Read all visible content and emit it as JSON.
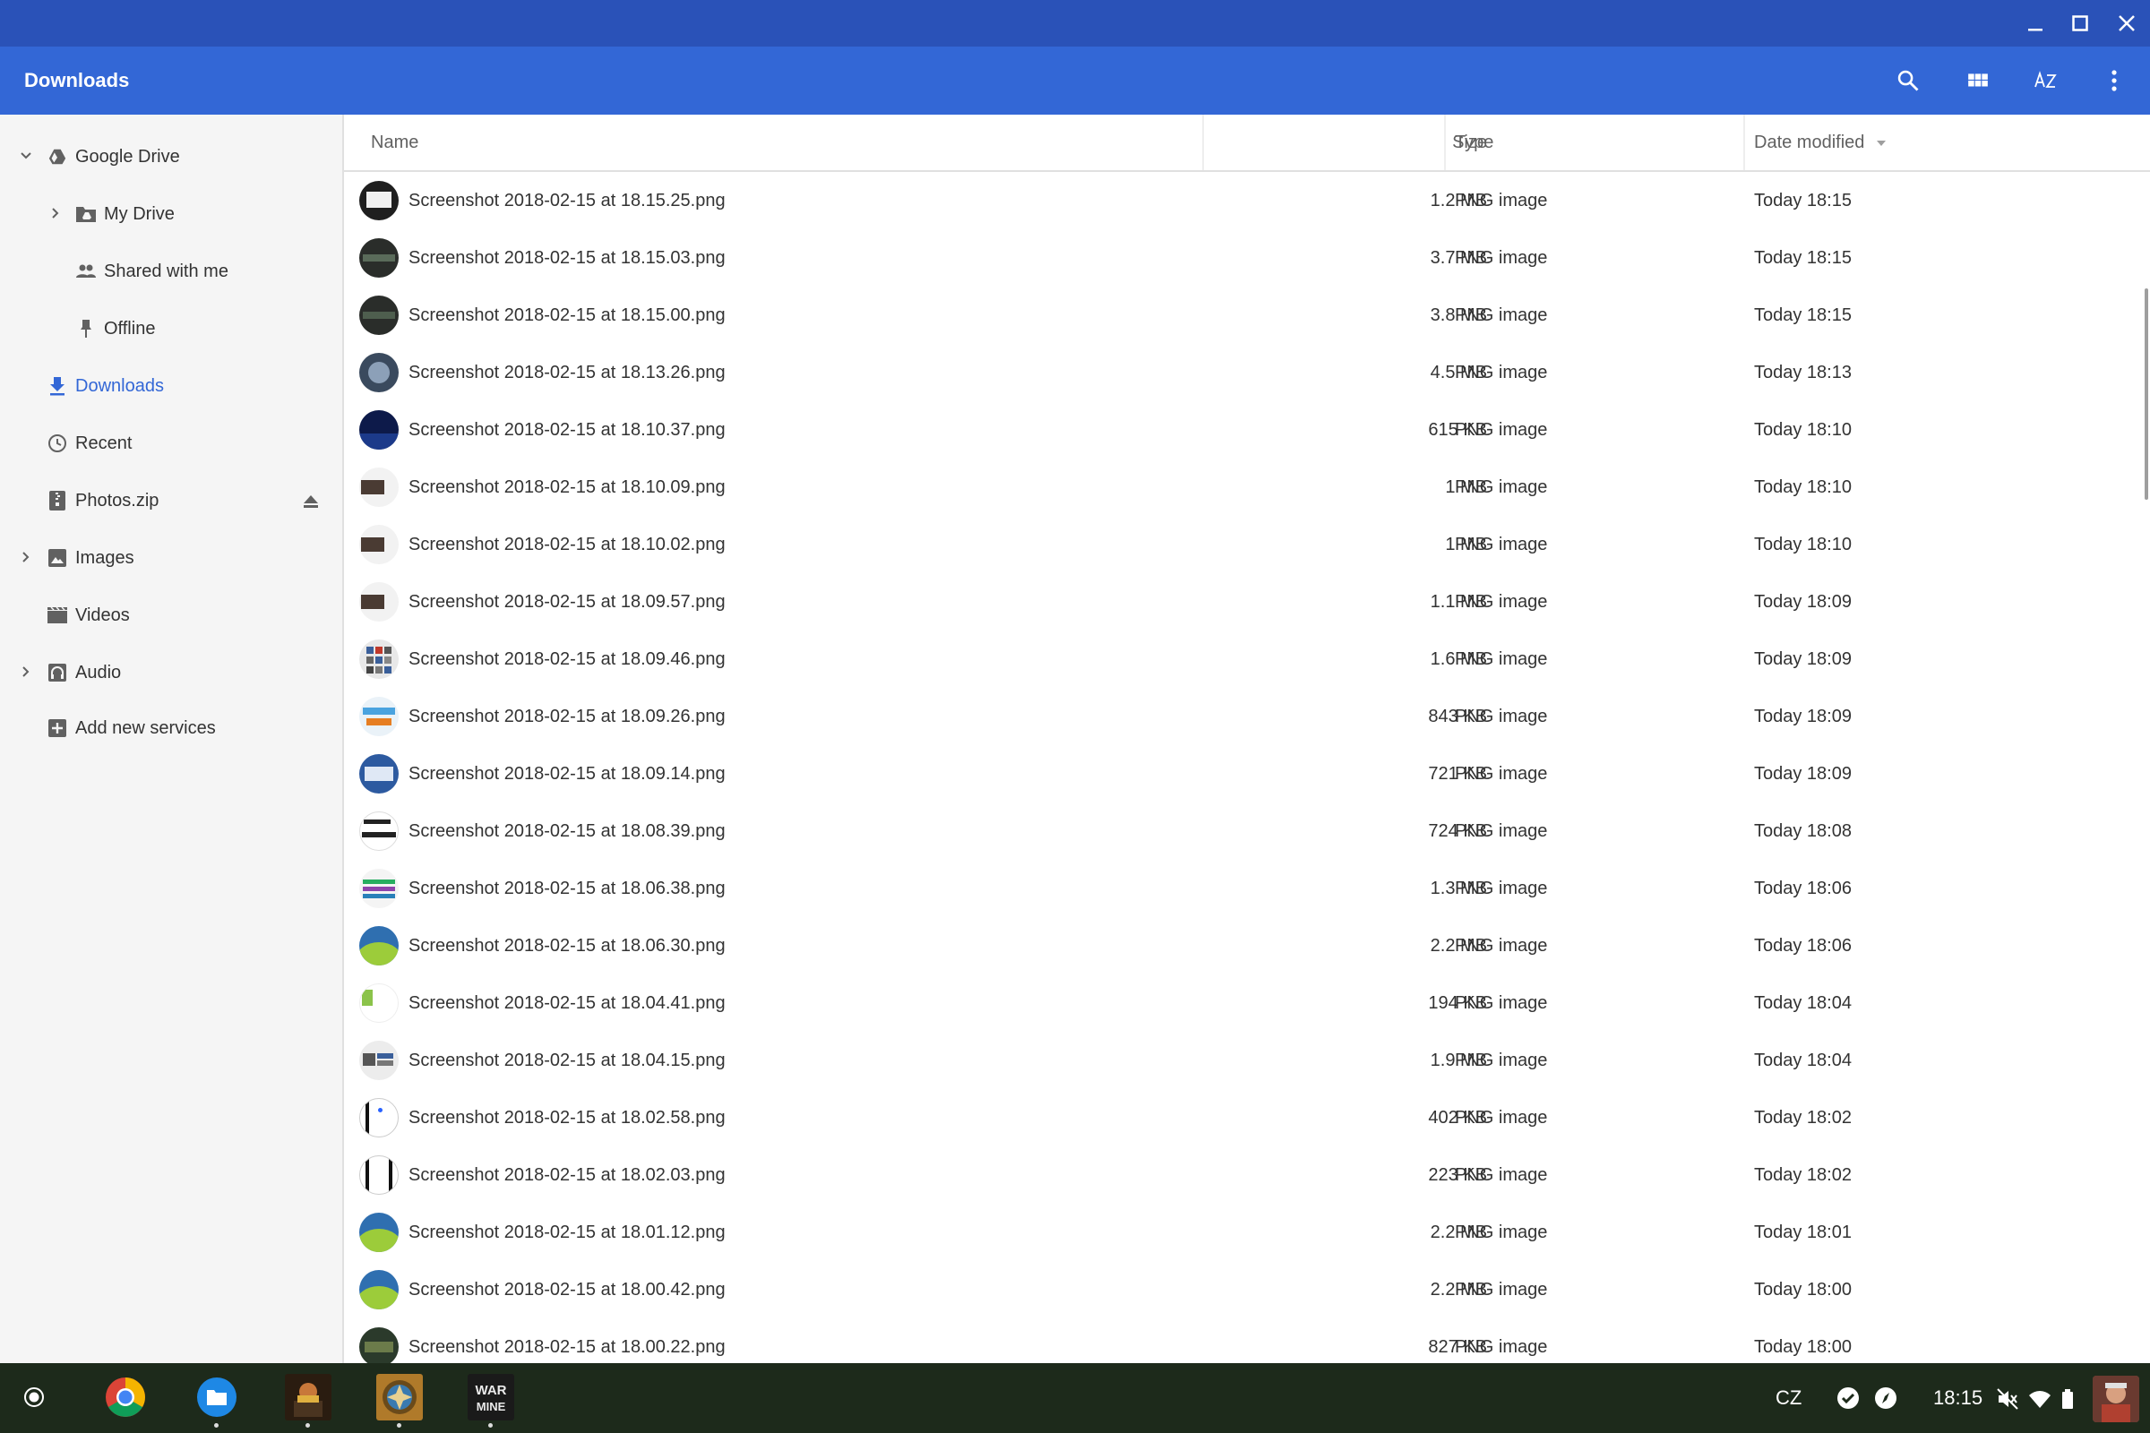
{
  "app": {
    "title": "Downloads"
  },
  "sidebar": {
    "items": [
      {
        "label": "Google Drive",
        "icon": "google-drive-icon"
      },
      {
        "label": "My Drive",
        "icon": "folder-drive-icon"
      },
      {
        "label": "Shared with me",
        "icon": "people-icon"
      },
      {
        "label": "Offline",
        "icon": "pin-icon"
      },
      {
        "label": "Downloads",
        "icon": "download-icon"
      },
      {
        "label": "Recent",
        "icon": "clock-icon"
      },
      {
        "label": "Photos.zip",
        "icon": "archive-icon"
      },
      {
        "label": "Images",
        "icon": "image-icon"
      },
      {
        "label": "Videos",
        "icon": "video-icon"
      },
      {
        "label": "Audio",
        "icon": "audio-icon"
      },
      {
        "label": "Add new services",
        "icon": "add-box-icon"
      }
    ]
  },
  "table": {
    "columns": {
      "name": "Name",
      "size": "Size",
      "type": "Type",
      "date": "Date modified"
    },
    "rows": [
      {
        "name": "Screenshot 2018-02-15 at 18.15.25.png",
        "size": "1.2 MB",
        "type": "PNG image",
        "date": "Today 18:15"
      },
      {
        "name": "Screenshot 2018-02-15 at 18.15.03.png",
        "size": "3.7 MB",
        "type": "PNG image",
        "date": "Today 18:15"
      },
      {
        "name": "Screenshot 2018-02-15 at 18.15.00.png",
        "size": "3.8 MB",
        "type": "PNG image",
        "date": "Today 18:15"
      },
      {
        "name": "Screenshot 2018-02-15 at 18.13.26.png",
        "size": "4.5 MB",
        "type": "PNG image",
        "date": "Today 18:13"
      },
      {
        "name": "Screenshot 2018-02-15 at 18.10.37.png",
        "size": "615 KB",
        "type": "PNG image",
        "date": "Today 18:10"
      },
      {
        "name": "Screenshot 2018-02-15 at 18.10.09.png",
        "size": "1 MB",
        "type": "PNG image",
        "date": "Today 18:10"
      },
      {
        "name": "Screenshot 2018-02-15 at 18.10.02.png",
        "size": "1 MB",
        "type": "PNG image",
        "date": "Today 18:10"
      },
      {
        "name": "Screenshot 2018-02-15 at 18.09.57.png",
        "size": "1.1 MB",
        "type": "PNG image",
        "date": "Today 18:09"
      },
      {
        "name": "Screenshot 2018-02-15 at 18.09.46.png",
        "size": "1.6 MB",
        "type": "PNG image",
        "date": "Today 18:09"
      },
      {
        "name": "Screenshot 2018-02-15 at 18.09.26.png",
        "size": "843 KB",
        "type": "PNG image",
        "date": "Today 18:09"
      },
      {
        "name": "Screenshot 2018-02-15 at 18.09.14.png",
        "size": "721 KB",
        "type": "PNG image",
        "date": "Today 18:09"
      },
      {
        "name": "Screenshot 2018-02-15 at 18.08.39.png",
        "size": "724 KB",
        "type": "PNG image",
        "date": "Today 18:08"
      },
      {
        "name": "Screenshot 2018-02-15 at 18.06.38.png",
        "size": "1.3 MB",
        "type": "PNG image",
        "date": "Today 18:06"
      },
      {
        "name": "Screenshot 2018-02-15 at 18.06.30.png",
        "size": "2.2 MB",
        "type": "PNG image",
        "date": "Today 18:06"
      },
      {
        "name": "Screenshot 2018-02-15 at 18.04.41.png",
        "size": "194 KB",
        "type": "PNG image",
        "date": "Today 18:04"
      },
      {
        "name": "Screenshot 2018-02-15 at 18.04.15.png",
        "size": "1.9 MB",
        "type": "PNG image",
        "date": "Today 18:04"
      },
      {
        "name": "Screenshot 2018-02-15 at 18.02.58.png",
        "size": "402 KB",
        "type": "PNG image",
        "date": "Today 18:02"
      },
      {
        "name": "Screenshot 2018-02-15 at 18.02.03.png",
        "size": "223 KB",
        "type": "PNG image",
        "date": "Today 18:02"
      },
      {
        "name": "Screenshot 2018-02-15 at 18.01.12.png",
        "size": "2.2 MB",
        "type": "PNG image",
        "date": "Today 18:01"
      },
      {
        "name": "Screenshot 2018-02-15 at 18.00.42.png",
        "size": "2.2 MB",
        "type": "PNG image",
        "date": "Today 18:00"
      },
      {
        "name": "Screenshot 2018-02-15 at 18.00.22.png",
        "size": "827 KB",
        "type": "PNG image",
        "date": "Today 18:00"
      }
    ]
  },
  "shelf": {
    "apps": [
      {
        "icon": "chrome-icon"
      },
      {
        "icon": "files-icon"
      },
      {
        "icon": "star-wars-game-icon"
      },
      {
        "icon": "hearthstone-icon"
      },
      {
        "icon": "this-war-of-mine-icon"
      }
    ],
    "war_icon_text_1": "WAR",
    "war_icon_text_2": "MINE",
    "ime": "CZ",
    "time": "18:15"
  },
  "colors": {
    "titlebar": "#2a52b8",
    "appbar": "#3367d6",
    "accent": "#3367d6",
    "sidebar_bg": "#f5f5f5",
    "shelf_bg": "#1d2a1b"
  }
}
